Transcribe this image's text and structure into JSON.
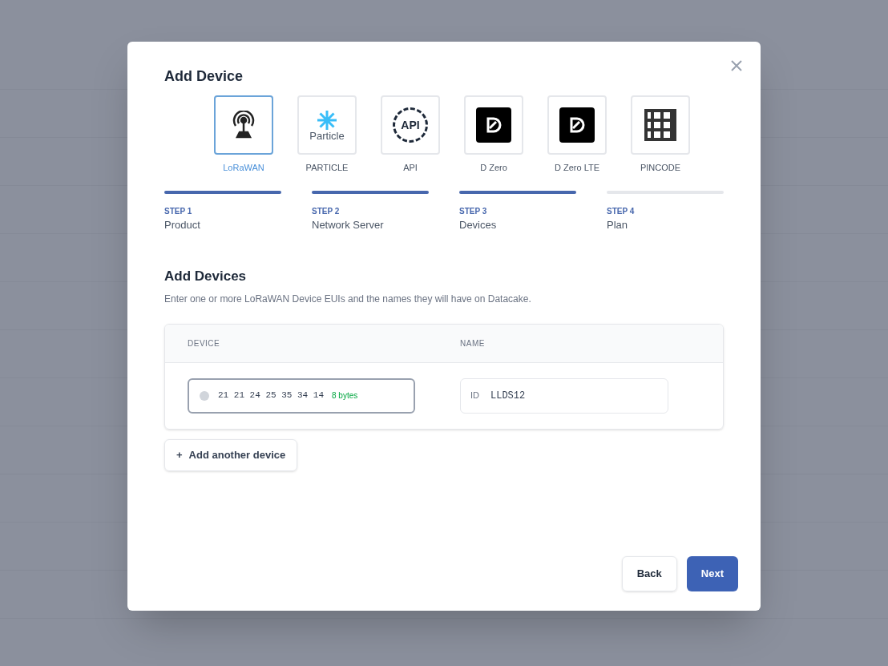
{
  "dialog": {
    "title": "Add Device"
  },
  "products": [
    {
      "kind": "lorawan",
      "label": "LoRaWAN",
      "selected": true
    },
    {
      "kind": "particle",
      "label": "PARTICLE",
      "logo_text": "Particle",
      "selected": false
    },
    {
      "kind": "api",
      "label": "API",
      "logo_text": "API",
      "selected": false
    },
    {
      "kind": "dzero",
      "label": "D Zero",
      "selected": false
    },
    {
      "kind": "dzero",
      "label": "D Zero LTE",
      "selected": false
    },
    {
      "kind": "qrcode",
      "label": "PINCODE",
      "selected": false
    }
  ],
  "steps": [
    {
      "step": "STEP 1",
      "name": "Product",
      "done": true
    },
    {
      "step": "STEP 2",
      "name": "Network Server",
      "done": true
    },
    {
      "step": "STEP 3",
      "name": "Devices",
      "done": true
    },
    {
      "step": "STEP 4",
      "name": "Plan",
      "done": false
    }
  ],
  "section": {
    "title": "Add Devices",
    "description": "Enter one or more LoRaWAN Device EUIs and the names they will have on Datacake."
  },
  "table": {
    "columns": [
      "DEVICE",
      "NAME"
    ],
    "rows": [
      {
        "device": "21 21 24 25 35 34 14",
        "device_hint": "8 bytes",
        "name_prefix": "ID",
        "name": "LLDS12"
      }
    ]
  },
  "add_button": {
    "icon": "+",
    "label": "Add another device"
  },
  "buttons": {
    "back": "Back",
    "next": "Next"
  }
}
